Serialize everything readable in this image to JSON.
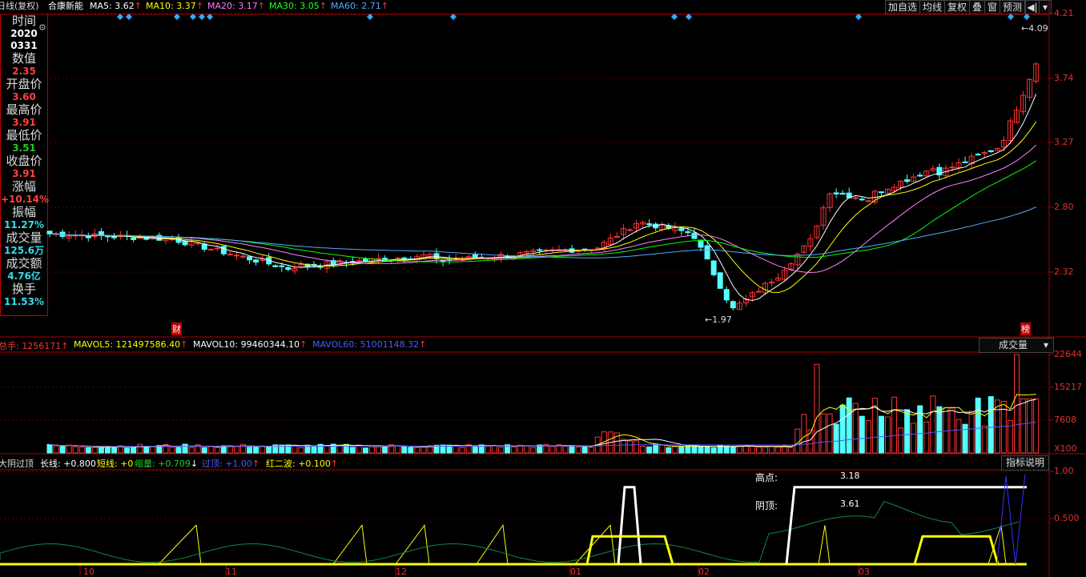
{
  "topbar": {
    "title_prefix": "日线(复权)",
    "stock_name": "合康新能",
    "ma5": "MA5: 3.62",
    "ma10": "MA10: 3.37",
    "ma20": "MA20: 3.17",
    "ma30": "MA30: 3.05",
    "ma60": "MA60: 2.71",
    "buttons": [
      "加自选",
      "均线",
      "复权",
      "叠",
      "窗",
      "预测"
    ]
  },
  "info_panel": {
    "items": [
      {
        "label": "时间",
        "value": "2020",
        "value2": "0331",
        "color": "#ffffff"
      },
      {
        "label": "数值",
        "value": "2.35",
        "color": "#ff4040"
      },
      {
        "label": "开盘价",
        "value": "3.60",
        "color": "#ff4040"
      },
      {
        "label": "最高价",
        "value": "3.91",
        "color": "#ff4040"
      },
      {
        "label": "最低价",
        "value": "3.51",
        "color": "#22cc22"
      },
      {
        "label": "收盘价",
        "value": "3.91",
        "color": "#ff4040"
      },
      {
        "label": "涨幅",
        "value": "+10.14%",
        "color": "#ff4040"
      },
      {
        "label": "振幅",
        "value": "11.27%",
        "color": "#33ddee"
      },
      {
        "label": "成交量",
        "value": "125.6万",
        "color": "#33ddee"
      },
      {
        "label": "成交额",
        "value": "4.76亿",
        "color": "#33ddee"
      },
      {
        "label": "换手",
        "value": "11.53%",
        "color": "#33ddee"
      }
    ]
  },
  "price_axis": [
    "4.21",
    "3.74",
    "3.27",
    "2.80",
    "2.32"
  ],
  "price_annotations": {
    "high": "4.09",
    "low": "1.97",
    "cai": "财",
    "bang": "榜"
  },
  "volume_panel": {
    "zongshou": "总手: 1256171",
    "mavol5": "MAVOL5: 121497586.40",
    "mavol10": "MAVOL10: 99460344.10",
    "mavol60": "MAVOL60: 51001148.32",
    "selector": "成交量",
    "axis": [
      "22644",
      "15217",
      "7608",
      "X100"
    ]
  },
  "indicator_panel": {
    "name": "大阴过顶",
    "long": "长线: +0.800",
    "short": "短线: +0",
    "shrink": "缩量: +0.709",
    "over": "过顶: +1.00",
    "red2": "红二波: +0.100",
    "explain_btn": "指标说明",
    "gaodian_label": "高点:",
    "gaodian_val": "3.18",
    "yinding_label": "阴顶:",
    "yinding_val": "3.61",
    "axis": [
      "1.00",
      "0.500"
    ]
  },
  "x_axis": [
    "10",
    "11",
    "12",
    "01",
    "02",
    "03"
  ],
  "colors": {
    "up": "#ff3232",
    "down": "#54ffff",
    "ma5": "#ffffff",
    "ma10": "#ffff00",
    "ma20": "#ff80ff",
    "ma30": "#00ff00",
    "ma60": "#55aaff"
  }
}
